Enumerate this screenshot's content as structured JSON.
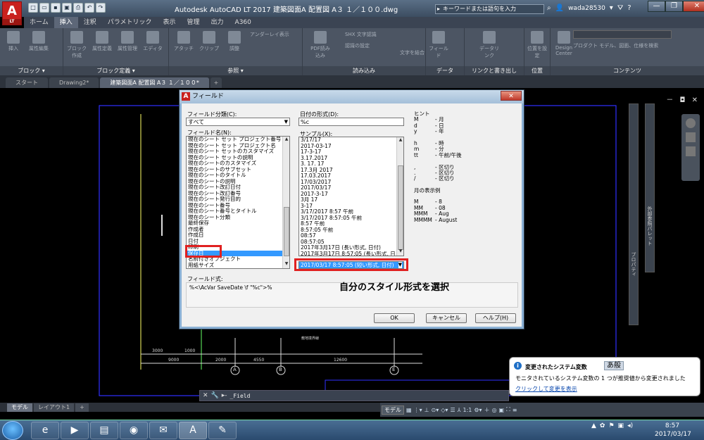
{
  "titlebar": {
    "logo": "A",
    "logo_sub": "LT",
    "title": "Autodesk AutoCAD LT 2017    建築図面A  配置図 A３ １／１００.dwg",
    "search_placeholder": "キーワードまたは語句を入力",
    "user": "wada28530"
  },
  "ribbon_tabs": [
    "ホーム",
    "挿入",
    "注釈",
    "パラメトリック",
    "表示",
    "管理",
    "出力",
    "A360"
  ],
  "ribbon_active_tab": "挿入",
  "ribbon": {
    "block_panel": {
      "title": "ブロック ▾",
      "buttons": [
        "挿入",
        "属性編集"
      ]
    },
    "block_def_panel": {
      "title": "ブロック定義 ▾",
      "buttons": [
        "ブロック作成",
        "属性定義",
        "属性管理",
        "エディタ"
      ]
    },
    "ref_panel": {
      "title": "参照 ▾",
      "buttons": [
        "アタッチ",
        "クリップ",
        "調整"
      ],
      "small": "アンダーレイ表示"
    },
    "import_panel": {
      "title": "読み込み",
      "buttons": [
        "PDF読み込み"
      ],
      "small1": "SHX 文字認識",
      "small2": "認識の設定",
      "small3": "文字を結合"
    },
    "data_panel": {
      "title": "データ",
      "buttons": [
        "フィールド"
      ]
    },
    "link_panel": {
      "title": "リンクと書き出し",
      "buttons": [
        "データリンク"
      ]
    },
    "location_panel": {
      "title": "位置",
      "buttons": [
        "位置を設定"
      ]
    },
    "content_panel": {
      "title": "コンテンツ",
      "small": "プロダクト モデル、図面、仕様を検索",
      "center": "Design Center"
    }
  },
  "file_tabs": [
    "スタート",
    "Drawing2*",
    "建築図面A 配置図 A３ １／１００*",
    "+"
  ],
  "file_tab_active": 2,
  "dialog": {
    "title": "フィールド",
    "close_label": "✕",
    "category_label": "フィールド分類(C):",
    "category_value": "すべて",
    "field_name_label": "フィールド名(N):",
    "field_names": [
      "現在のシート セット プロジェクト番号",
      "現在のシート セット プロジェクト名",
      "現在のシート セットのカスタマイズ",
      "現在のシート セットの説明",
      "現在のシートのカスタマイズ",
      "現在のシートのサブセット",
      "現在のシートのタイトル",
      "現在のシートの説明",
      "現在のシート改訂日付",
      "現在のシート改訂番号",
      "現在のシート発行目的",
      "現在のシート番号",
      "現在のシート番号とタイトル",
      "現在のシート分類",
      "最終保存",
      "作成者",
      "作成日",
      "日付",
      "印刷",
      "保存日",
      "名前付きオブジェクト",
      "用紙サイズ"
    ],
    "field_name_selected": 19,
    "date_format_label": "日付の形式(D):",
    "date_format_value": "%c",
    "sample_label": "サンプル(X):",
    "samples": [
      "3/17/17",
      "2017-03-17",
      "17-3-17",
      "3.17.2017",
      "3. 17. 17",
      "17.3月 2017",
      "17.03.2017",
      "17/03/2017",
      "2017/03/17",
      "2017-3-17",
      "3月 17",
      "3-17",
      "3/17/2017 8:57 午前",
      "3/17/2017 8:57:05 午前",
      "8:57 午前",
      "8:57:05 午前",
      "08:57",
      "08:57:05",
      "2017年3月17日 (長い形式, 日付)",
      "2017年3月17日 8:57:05 (長い形式, 日"
    ],
    "sample_selected": "2017/03/17 8:57:05 (短い形式, 日付)",
    "hint_label": "ヒント",
    "hints": [
      [
        "M",
        "-  月"
      ],
      [
        "d",
        "-  日"
      ],
      [
        "y",
        "-  年"
      ],
      [
        "",
        ""
      ],
      [
        "h",
        "-  時"
      ],
      [
        "m",
        "-  分"
      ],
      [
        "tt",
        "-  午前/午後"
      ],
      [
        "",
        ""
      ],
      [
        ",",
        "-  区切り"
      ],
      [
        ".",
        "-  区切り"
      ],
      [
        "/",
        "-  区切り"
      ]
    ],
    "month_label": "月の表示例",
    "month_examples": [
      [
        "M",
        "-  8"
      ],
      [
        "MM",
        "-  08"
      ],
      [
        "MMM",
        "-  Aug"
      ],
      [
        "MMMM",
        "-  August"
      ]
    ],
    "field_expr_label": "フィールド式:",
    "field_expr": "%<\\AcVar SaveDate \\f \"%c\">%",
    "callout": "自分のスタイル形式を選択",
    "ok": "OK",
    "cancel": "キャンセル",
    "help": "ヘルプ(H)"
  },
  "drawing": {
    "viewport_controls": "－ ◘ ✕",
    "dims": [
      "3000",
      "1000",
      "9000",
      "2000",
      "4550",
      "12600"
    ],
    "grid_labels": [
      "A",
      "B",
      "E"
    ],
    "center_label": "敷地境界線",
    "palette_label": "プロパティ",
    "palette2_label": "外部参照パレット"
  },
  "command": {
    "text": "_Field",
    "icons": [
      "✕",
      "🔧"
    ]
  },
  "layout_tabs": [
    "モデル",
    "レイアウト1",
    "+"
  ],
  "layout_active": 0,
  "status": {
    "model": "モデル",
    "scale": "1:1"
  },
  "notification": {
    "title": "変更されたシステム変数",
    "body": "モニタされているシステム変数の 1 つが推奨値から変更されました",
    "link": "クリックして変更を表示",
    "ime": "あ般"
  },
  "taskbar": {
    "time": "8:57",
    "date": "2017/03/17"
  }
}
